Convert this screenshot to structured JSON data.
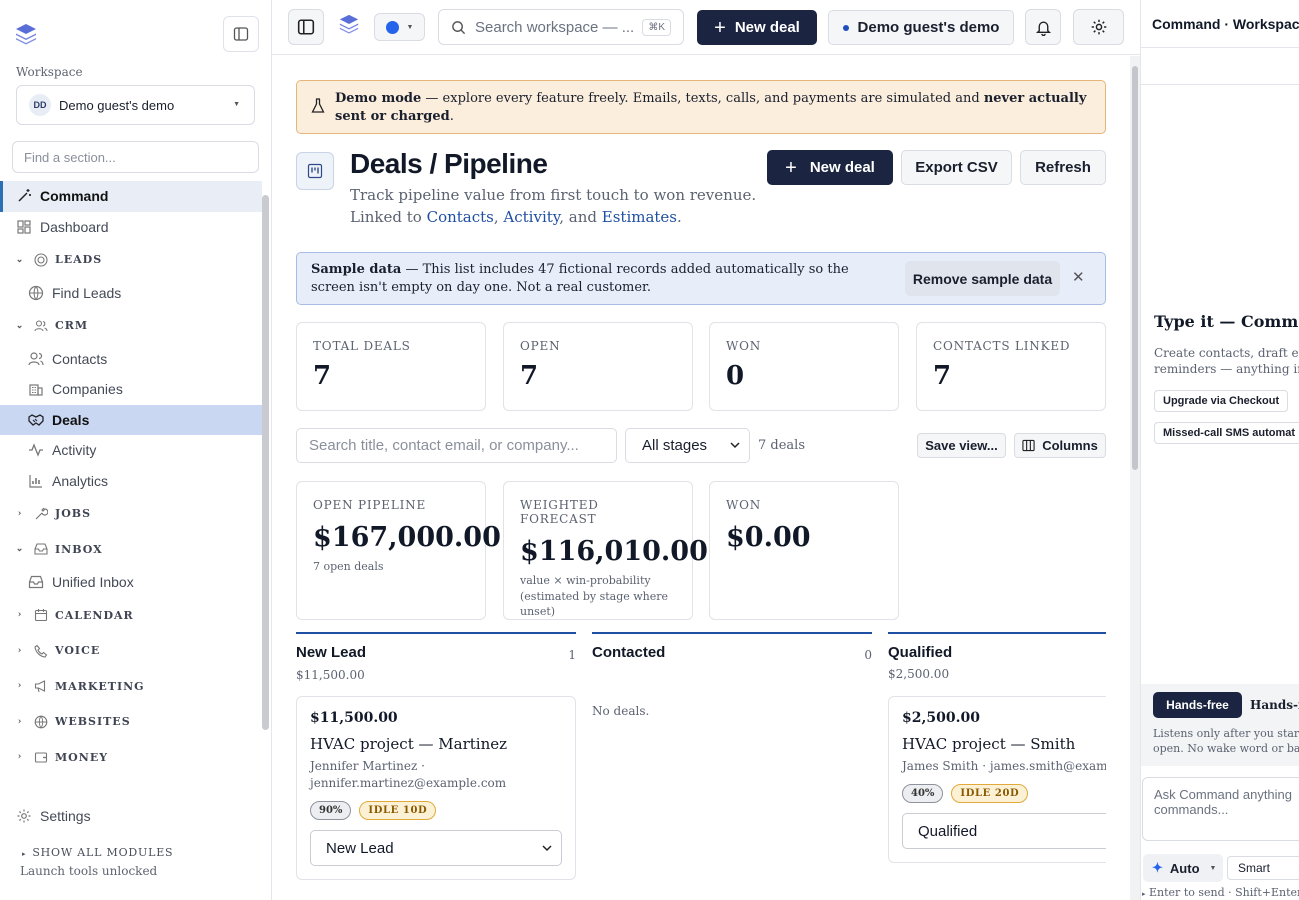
{
  "sidebar": {
    "workspace_label": "Workspace",
    "workspace_initials": "DD",
    "workspace_name": "Demo guest's demo",
    "find_placeholder": "Find a section...",
    "items": {
      "command": "Command",
      "dashboard": "Dashboard",
      "leads": "LEADS",
      "find_leads": "Find Leads",
      "crm": "CRM",
      "contacts": "Contacts",
      "companies": "Companies",
      "deals": "Deals",
      "activity": "Activity",
      "analytics": "Analytics",
      "jobs": "JOBS",
      "inbox": "INBOX",
      "unified_inbox": "Unified Inbox",
      "calendar": "CALENDAR",
      "voice": "VOICE",
      "marketing": "MARKETING",
      "websites": "WEBSITES",
      "money": "MONEY"
    },
    "settings": "Settings",
    "show_all": "SHOW ALL MODULES",
    "unlocked": "Launch tools unlocked"
  },
  "topbar": {
    "search_placeholder": "Search workspace — ...",
    "shortcut": "⌘K",
    "new_deal": "New deal",
    "workspace": "Demo guest's demo"
  },
  "banner": {
    "bold1": "Demo mode",
    "text1": " — explore every feature freely. Emails, texts, calls, and payments are simulated and ",
    "bold2": "never actually sent or charged",
    "text2": "."
  },
  "page": {
    "title": "Deals / Pipeline",
    "subtitle": "Track pipeline value from first touch to won revenue.",
    "linked_prefix": "Linked to ",
    "link_contacts": "Contacts",
    "link_activity": "Activity",
    "link_estimates": "Estimates",
    "sep1": ", ",
    "sep2": ", and ",
    "end": ".",
    "new_deal": "New deal",
    "export": "Export CSV",
    "refresh": "Refresh"
  },
  "sample": {
    "bold": "Sample data",
    "text": " — This list includes 47 fictional records added automatically so the screen isn't empty on day one. Not a real customer.",
    "remove": "Remove sample data"
  },
  "stats": [
    {
      "label": "TOTAL DEALS",
      "value": "7"
    },
    {
      "label": "OPEN",
      "value": "7"
    },
    {
      "label": "WON",
      "value": "0"
    },
    {
      "label": "CONTACTS LINKED",
      "value": "7"
    }
  ],
  "filters": {
    "search_placeholder": "Search title, contact email, or company...",
    "stage": "All stages",
    "count": "7 deals",
    "save_view": "Save view...",
    "columns": "Columns"
  },
  "forecast": [
    {
      "label": "OPEN PIPELINE",
      "value": "$167,000.00",
      "note": "7 open deals"
    },
    {
      "label": "WEIGHTED FORECAST",
      "value": "$116,010.00",
      "note": "value × win-probability (estimated by stage where unset)"
    },
    {
      "label": "WON",
      "value": "$0.00",
      "note": ""
    }
  ],
  "columns": [
    {
      "name": "New Lead",
      "count": "1",
      "sum": "$11,500.00",
      "card": {
        "amount": "$11,500.00",
        "title": "HVAC project — Martinez",
        "contact": "Jennifer Martinez · jennifer.martinez@example.com",
        "pct": "90%",
        "idle": "IDLE 10D",
        "stage": "New Lead"
      }
    },
    {
      "name": "Contacted",
      "count": "0",
      "sum": "",
      "empty": "No deals."
    },
    {
      "name": "Qualified",
      "count": "",
      "sum": "$2,500.00",
      "card": {
        "amount": "$2,500.00",
        "title": "HVAC project — Smith",
        "contact": "James Smith · james.smith@exampl",
        "pct": "40%",
        "idle": "IDLE 20D",
        "stage": "Qualified"
      }
    }
  ],
  "right": {
    "title": "Command · Workspace",
    "heading": "Type it — Command",
    "desc1": "Create contacts, draft ema",
    "desc2": "reminders — anything in",
    "chip1": "Upgrade via Checkout",
    "chip2": "Missed-call SMS automat",
    "hands_free": "Hands-free",
    "hands_free_label": "Hands-fr",
    "hf_desc1": "Listens only after you start",
    "hf_desc2": "open. No wake word or bac",
    "ask_placeholder": "Ask Command anything commands...",
    "auto": "Auto",
    "smart": "Smart",
    "hint": "Enter to send · Shift+Enter for"
  },
  "colors": {
    "accent": "#1b2440",
    "link": "#1f4fa3",
    "warning_bg": "#fbeedc",
    "info_bg": "#e8eef9"
  }
}
